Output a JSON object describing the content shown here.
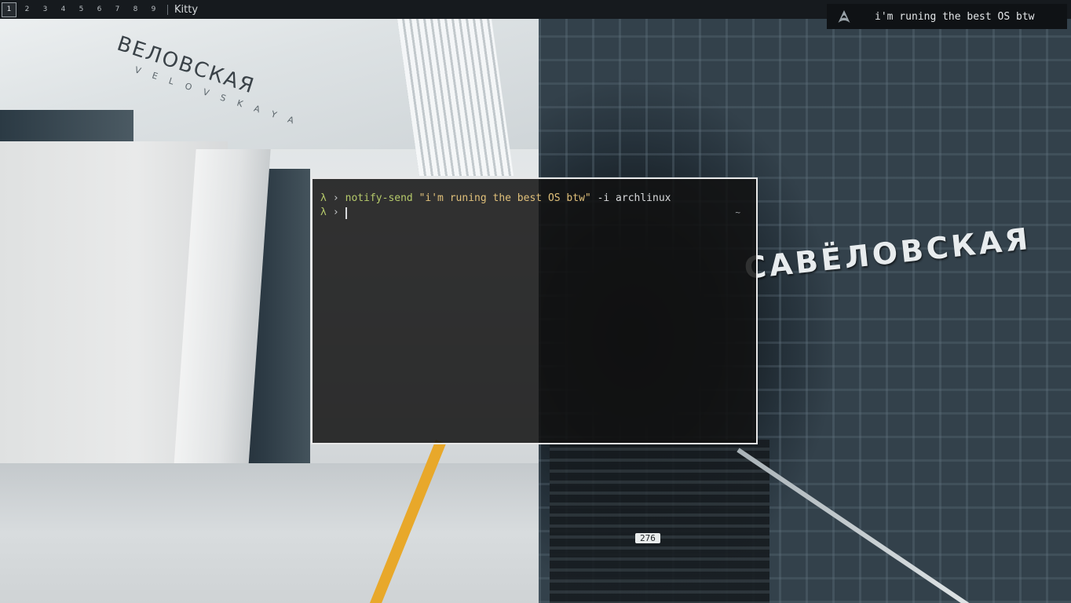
{
  "topbar": {
    "workspaces": [
      "1",
      "2",
      "3",
      "4",
      "5",
      "6",
      "7",
      "8",
      "9"
    ],
    "active_workspace": "1",
    "window_title": "Kitty"
  },
  "notification": {
    "icon": "archlinux-icon",
    "text": "i'm runing the best OS btw"
  },
  "terminal": {
    "prompt_symbol": "λ",
    "prompt_arrow": "›",
    "history": [
      {
        "command": "notify-send",
        "string_arg": "\"i'm runing the best OS btw\"",
        "flags": "-i archlinux"
      }
    ],
    "cwd": "~"
  },
  "wallpaper": {
    "left_sign": "ВЕЛОВСКАЯ",
    "left_sign_sub": "V E L O V S K A Y A",
    "right_sign": "САВЁЛОВСКАЯ",
    "track_number": "276"
  },
  "colors": {
    "topbar_bg": "#161a1e",
    "terminal_border": "#e8e8e8",
    "prompt_green": "#b5c96a",
    "string_yellow": "#e0c07a"
  }
}
